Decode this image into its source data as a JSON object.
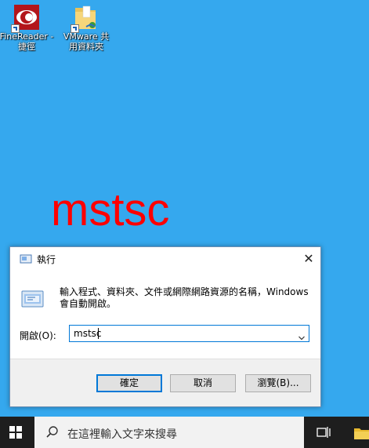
{
  "desktop": {
    "icons": [
      {
        "label": "FineReader -\n捷徑"
      },
      {
        "label": "VMware 共\n用資料夾"
      }
    ],
    "overlay_text": "mstsc",
    "overlay_color": "#ff0000"
  },
  "run_dialog": {
    "title": "執行",
    "description": "輸入程式、資料夾、文件或網際網路資源的名稱，Windows 會自動開啟。",
    "open_label": "開啟(O):",
    "input_value": "mstsc",
    "buttons": {
      "ok": "確定",
      "cancel": "取消",
      "browse": "瀏覽(B)..."
    },
    "accent": "#0078d7"
  },
  "taskbar": {
    "search_placeholder": "在這裡輸入文字來搜尋"
  }
}
